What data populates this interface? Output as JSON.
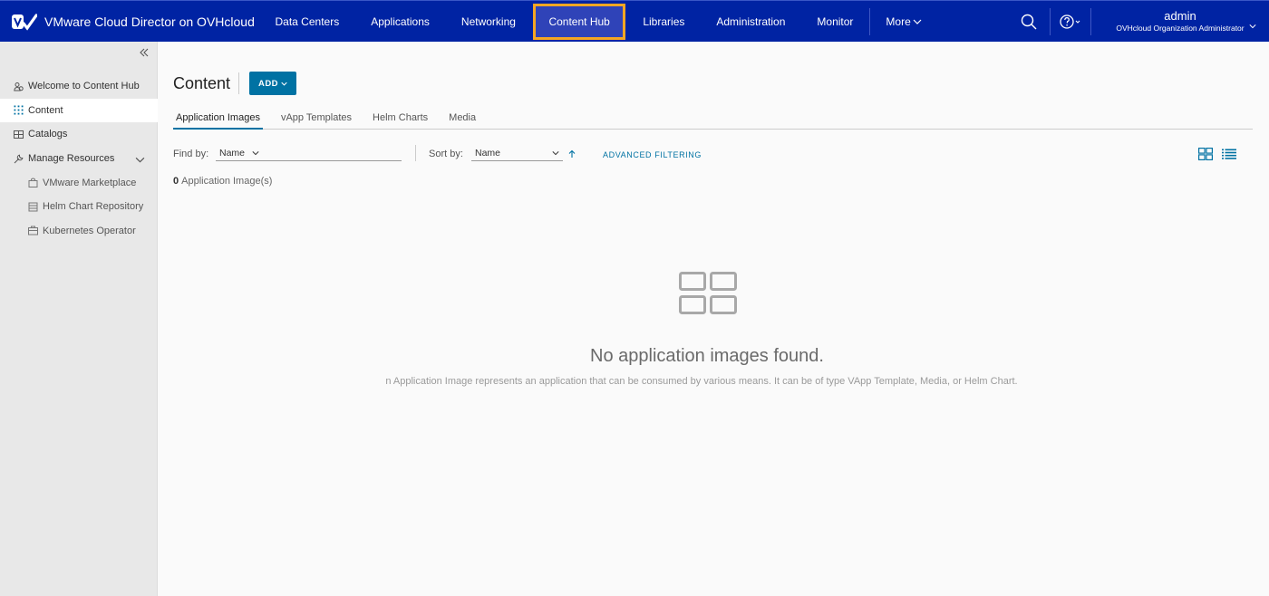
{
  "header": {
    "brand_title": "VMware Cloud Director on OVHcloud",
    "nav": [
      {
        "label": "Data Centers"
      },
      {
        "label": "Applications"
      },
      {
        "label": "Networking"
      },
      {
        "label": "Content Hub",
        "active": true
      },
      {
        "label": "Libraries"
      },
      {
        "label": "Administration"
      },
      {
        "label": "Monitor"
      }
    ],
    "more_label": "More",
    "user_name": "admin",
    "user_role": "OVHcloud Organization Administrator",
    "colors": {
      "bar": "#0023a3",
      "active_tab": "#2f43b8",
      "highlight_border": "#f5a623"
    }
  },
  "sidebar": {
    "items": [
      {
        "label": "Welcome to Content Hub",
        "icon": "user-group-icon"
      },
      {
        "label": "Content",
        "icon": "grid-dots-icon",
        "active": true
      },
      {
        "label": "Catalogs",
        "icon": "catalog-icon"
      },
      {
        "label": "Manage Resources",
        "icon": "wrench-icon",
        "expanded": true
      },
      {
        "label": "VMware Marketplace",
        "icon": "shopping-bag-icon",
        "sub": true
      },
      {
        "label": "Helm Chart Repository",
        "icon": "repository-icon",
        "sub": true
      },
      {
        "label": "Kubernetes Operator",
        "icon": "briefcase-icon",
        "sub": true
      }
    ]
  },
  "main": {
    "title": "Content",
    "add_label": "ADD",
    "tabs": [
      {
        "label": "Application Images",
        "active": true
      },
      {
        "label": "vApp Templates"
      },
      {
        "label": "Helm Charts"
      },
      {
        "label": "Media"
      }
    ],
    "find_label": "Find by:",
    "find_value": "Name",
    "sort_label": "Sort by:",
    "sort_value": "Name",
    "advanced_filtering": "ADVANCED FILTERING",
    "count_number": "0",
    "count_text": "Application Image(s)",
    "empty_title": "No application images found.",
    "empty_desc": "An Application Image represents an application that can be consumed by various means. It can be of type VApp Template, Media, or Helm Chart.",
    "accent_color": "#0072a3"
  }
}
